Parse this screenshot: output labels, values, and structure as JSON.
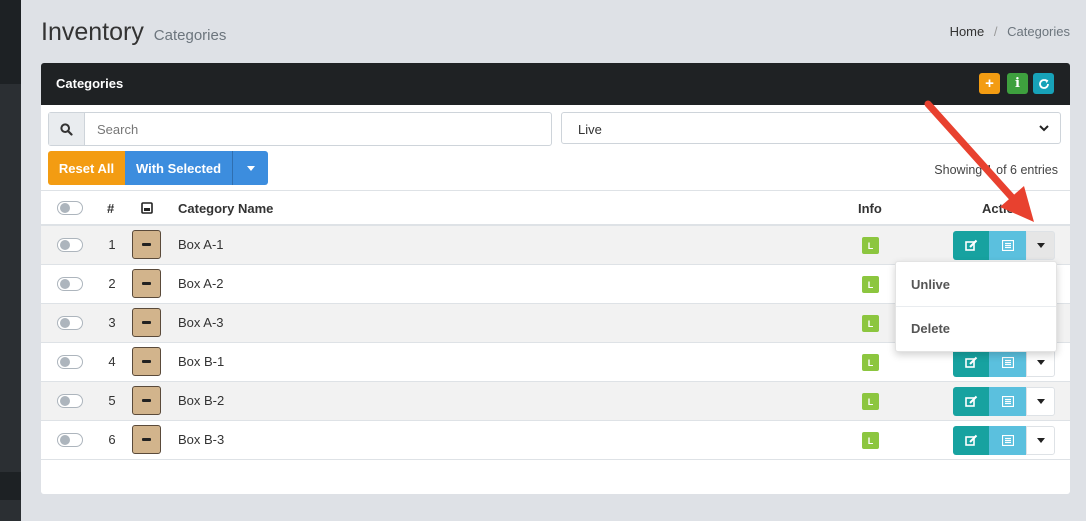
{
  "page": {
    "title": "Inventory",
    "subtitle": "Categories"
  },
  "breadcrumb": {
    "home": "Home",
    "separator": "/",
    "current": "Categories"
  },
  "card": {
    "title": "Categories",
    "header_buttons": [
      {
        "name": "add",
        "icon": "plus-icon",
        "color": "#f39c12"
      },
      {
        "name": "info",
        "icon": "info-icon",
        "color": "#3ea03e"
      },
      {
        "name": "refresh",
        "icon": "refresh-icon",
        "color": "#17a2b8"
      }
    ]
  },
  "search": {
    "placeholder": "Search",
    "value": ""
  },
  "status_filter": {
    "selected": "Live"
  },
  "toolbar": {
    "reset_label": "Reset All",
    "with_selected_label": "With Selected"
  },
  "showing_text": "Showing 1 of 6 entries",
  "table": {
    "headers": {
      "index": "#",
      "image": "image-icon",
      "name": "Category Name",
      "info": "Info",
      "actions": "Actions"
    },
    "rows": [
      {
        "index": "1",
        "name": "Box A-1",
        "info": "L"
      },
      {
        "index": "2",
        "name": "Box A-2",
        "info": "L"
      },
      {
        "index": "3",
        "name": "Box A-3",
        "info": "L"
      },
      {
        "index": "4",
        "name": "Box B-1",
        "info": "L"
      },
      {
        "index": "5",
        "name": "Box B-2",
        "info": "L"
      },
      {
        "index": "6",
        "name": "Box B-3",
        "info": "L"
      }
    ]
  },
  "row_dropdown": {
    "items": [
      "Unlive",
      "Delete"
    ]
  },
  "colors": {
    "accent_orange": "#f39c12",
    "accent_blue": "#3c8dde",
    "teal": "#17a2a0",
    "light_blue": "#5bc0de",
    "badge_green": "#8cc63f",
    "arrow_red": "#e8412f"
  }
}
